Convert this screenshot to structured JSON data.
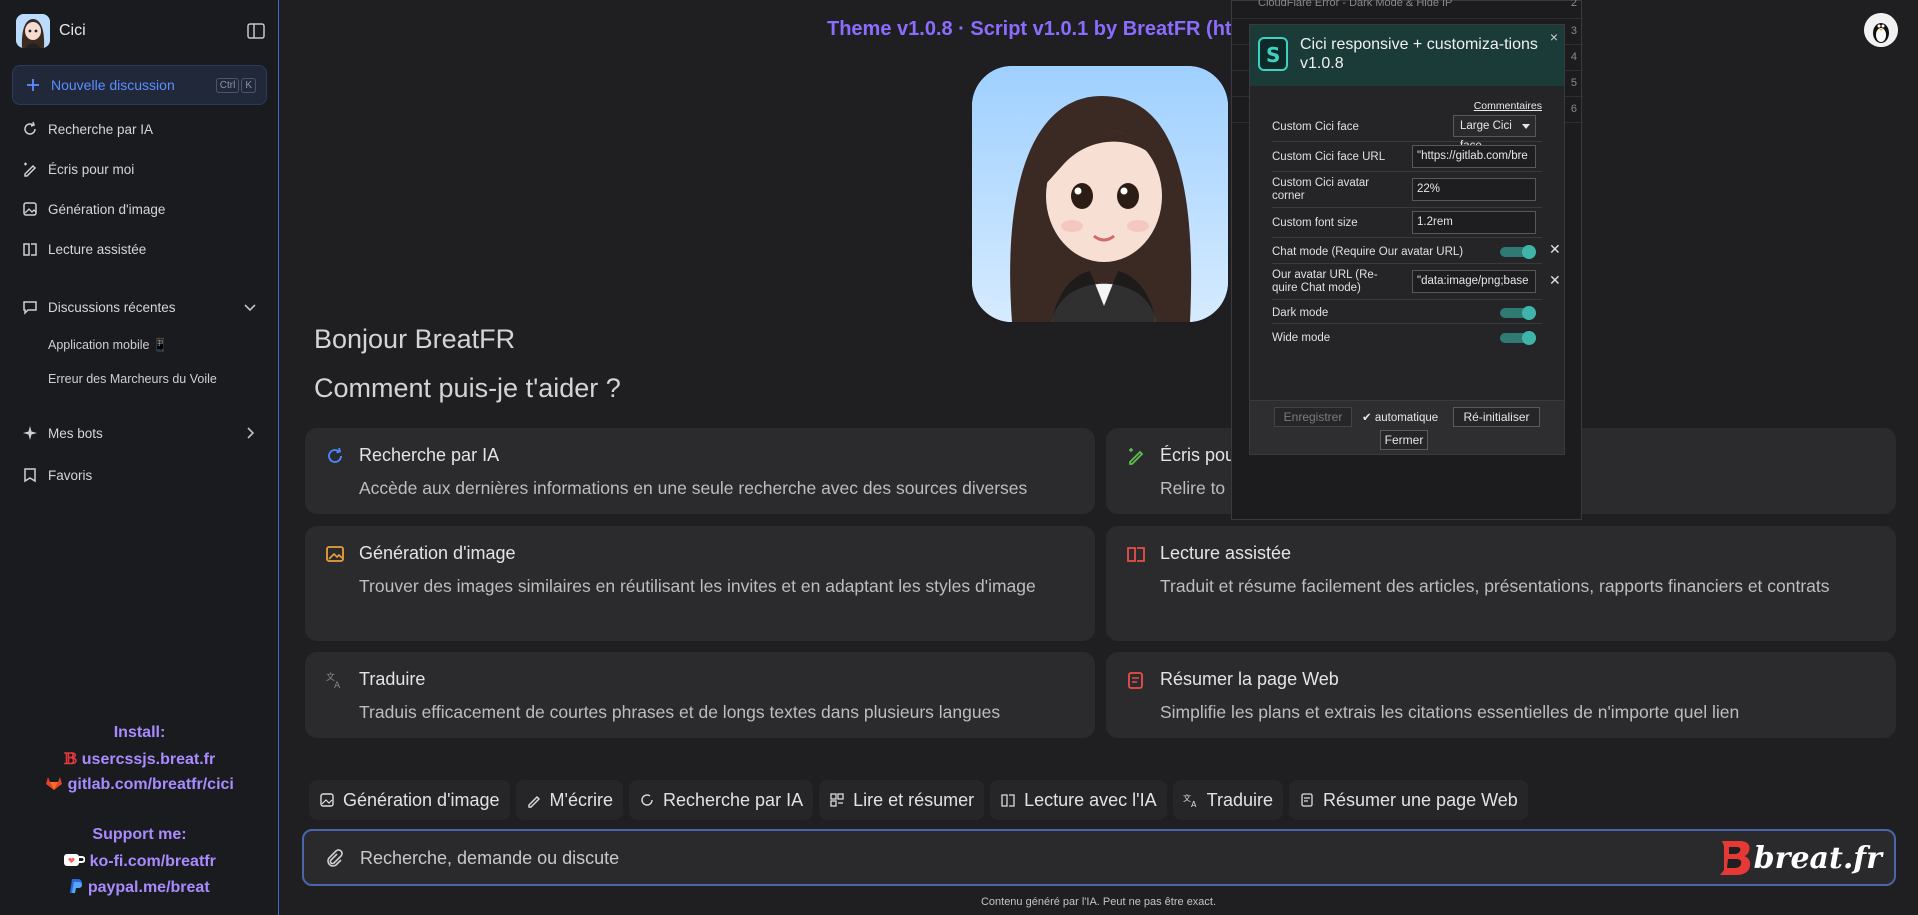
{
  "sidebar": {
    "app_title": "Cici",
    "new_discussion": "Nouvelle discussion",
    "shortcut": [
      "Ctrl",
      "K"
    ],
    "items": [
      {
        "label": "Recherche par IA",
        "icon": "search-ai-icon"
      },
      {
        "label": "Écris pour moi",
        "icon": "pen-icon"
      },
      {
        "label": "Génération d'image",
        "icon": "image-icon"
      },
      {
        "label": "Lecture assistée",
        "icon": "book-icon"
      }
    ],
    "recent": {
      "label": "Discussions récentes",
      "items": [
        "Application mobile 📱",
        "Erreur des Marcheurs du Voile"
      ]
    },
    "bots": "Mes bots",
    "favorites": "Favoris",
    "install_label": "Install:",
    "install_links": [
      "usercssjs.breat.fr",
      "gitlab.com/breatfr/cici"
    ],
    "support_label": "Support me:",
    "support_links": [
      "ko-fi.com/breatfr",
      "paypal.me/breat"
    ]
  },
  "header": {
    "title": "Theme v1.0.8 · Script v1.0.1 by BreatFR (ht"
  },
  "main": {
    "greeting": "Bonjour BreatFR",
    "question": "Comment puis-je t'aider ?",
    "cards": [
      {
        "title": "Recherche par IA",
        "desc": "Accède aux dernières informations en une seule recherche avec des sources diverses",
        "color": "#4a8cff"
      },
      {
        "title": "Écris pou",
        "desc": "Relire to",
        "color": "#5cc04a"
      },
      {
        "title": "Génération d'image",
        "desc": "Trouver des images similaires en réutilisant les invites et en adaptant les styles d'image",
        "color": "#e8a13a"
      },
      {
        "title": "Lecture assistée",
        "desc": "Traduit et résume facilement des articles, présentations, rapports financiers et contrats",
        "color": "#e8504a"
      },
      {
        "title": "Traduire",
        "desc": "Traduis efficacement de courtes phrases et de longs textes dans plusieurs langues",
        "color": "#8a8a8e"
      },
      {
        "title": "Résumer la page Web",
        "desc": "Simplifie les plans et extrais les citations essentielles de n'importe quel lien",
        "color": "#e8504a"
      }
    ],
    "chips": [
      "Génération d'image",
      "M'écrire",
      "Recherche par IA",
      "Lire et résumer",
      "Lecture avec l'IA",
      "Traduire",
      "Résumer une page Web"
    ],
    "input_placeholder": "Recherche, demande ou discute",
    "brand": "breat.fr",
    "footer": "Contenu généré par l'IA. Peut ne pas être exact."
  },
  "background_panel": {
    "rows": [
      "CloudFlare Error - Dark Mode & Hide IP",
      "",
      "",
      "",
      "",
      ""
    ],
    "numbers": [
      "2",
      "3",
      "4",
      "5",
      "6"
    ]
  },
  "dialog": {
    "title": "Cici responsive + customiza-tions v1.0.8",
    "close": "×",
    "comments": "Commentaires",
    "fields": {
      "face": {
        "label": "Custom Cici face",
        "value": "Large Cici face"
      },
      "face_url": {
        "label": "Custom Cici face URL",
        "value": "\"https://gitlab.com/bre"
      },
      "corner": {
        "label": "Custom Cici avatar corner",
        "value": "22%"
      },
      "font": {
        "label": "Custom font size",
        "value": "1.2rem"
      },
      "chat": {
        "label": "Chat mode (Require Our avatar URL)"
      },
      "our_avatar": {
        "label": "Our avatar URL (Re-quire Chat mode)",
        "value": "\"data:image/png;base"
      },
      "dark": {
        "label": "Dark mode"
      },
      "wide": {
        "label": "Wide mode"
      }
    },
    "buttons": {
      "save": "Enregistrer",
      "auto": "automatique",
      "reset": "Ré-initialiser",
      "close": "Fermer"
    }
  }
}
